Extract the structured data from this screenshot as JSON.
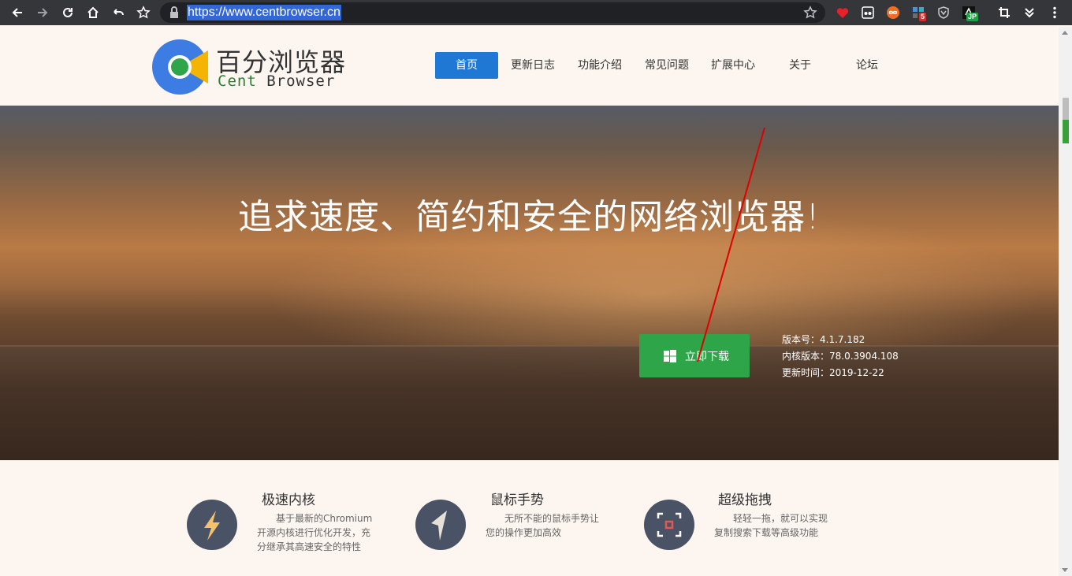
{
  "browser": {
    "url": "https://www.centbrowser.cn",
    "badge_count": "5",
    "badge_jp": "JP"
  },
  "site": {
    "brand_cn": "百分浏览器",
    "brand_en_prefix": "Cent",
    "brand_en_suffix": " Browser",
    "nav": [
      {
        "label": "首页",
        "active": true
      },
      {
        "label": "更新日志"
      },
      {
        "label": "功能介绍"
      },
      {
        "label": "常见问题"
      },
      {
        "label": "扩展中心"
      },
      {
        "label": "关于"
      },
      {
        "label": "论坛"
      }
    ]
  },
  "hero": {
    "title": "追求速度、简约和安全的网络浏览器!",
    "download_label": "立即下载",
    "version": "版本号：4.1.7.182",
    "kernel": "内核版本：78.0.3904.108",
    "updated": "更新时间：2019-12-22"
  },
  "features": [
    {
      "title": "极速内核",
      "icon": "lightning-icon",
      "desc": [
        "基于最新的Chromium",
        "开源内核进行优化开发，充",
        "分继承其高速安全的特性"
      ]
    },
    {
      "title": "鼠标手势",
      "icon": "cursor-arrow-icon",
      "desc": [
        "无所不能的鼠标手势让",
        "您的操作更加高效"
      ]
    },
    {
      "title": "超级拖拽",
      "icon": "drag-frame-icon",
      "desc": [
        "轻轻一拖，就可以实现",
        "复制搜索下载等高级功能"
      ]
    }
  ],
  "colors": {
    "nav_active": "#1e78d4",
    "download_button": "#2fa54a",
    "feature_icon_bg": "#4a5266",
    "annotation_line": "#e00000"
  }
}
